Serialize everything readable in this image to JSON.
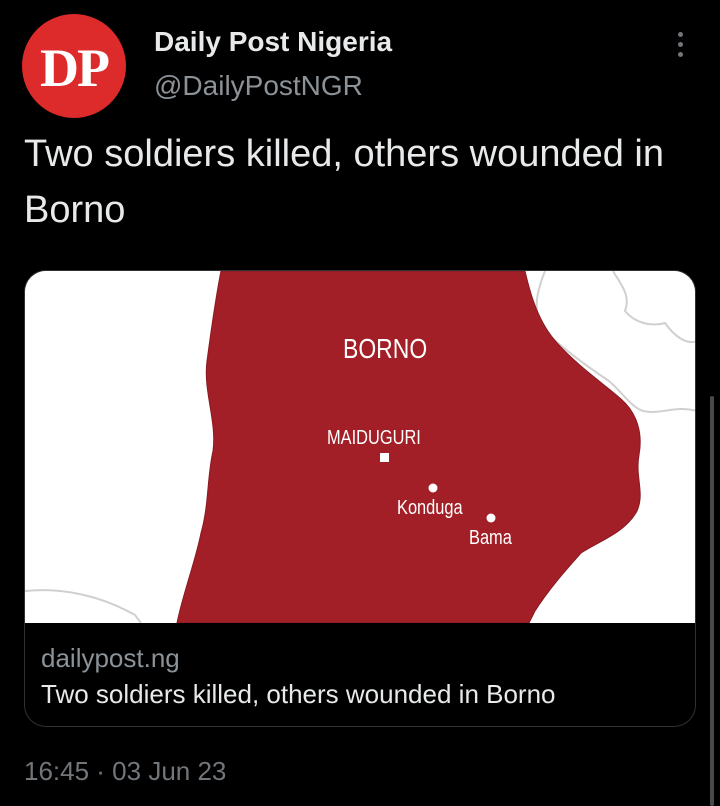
{
  "author": {
    "avatar_text": "DP",
    "name": "Daily Post Nigeria",
    "handle": "@DailyPostNGR"
  },
  "tweet": {
    "text": "Two soldiers killed, others wounded in Borno",
    "timestamp": "16:45 · 03 Jun 23"
  },
  "card": {
    "domain": "dailypost.ng",
    "title": "Two soldiers killed, others wounded in Borno",
    "map": {
      "state_label": "BORNO",
      "cities": [
        "MAIDUGURI",
        "Konduga",
        "Bama"
      ]
    }
  },
  "icons": {
    "more": "more-vertical-icon"
  },
  "colors": {
    "background": "#000000",
    "avatar": "#dd2a2a",
    "map_region": "#a31f27",
    "text_primary": "#e7e9ea",
    "text_secondary": "#71767b"
  }
}
